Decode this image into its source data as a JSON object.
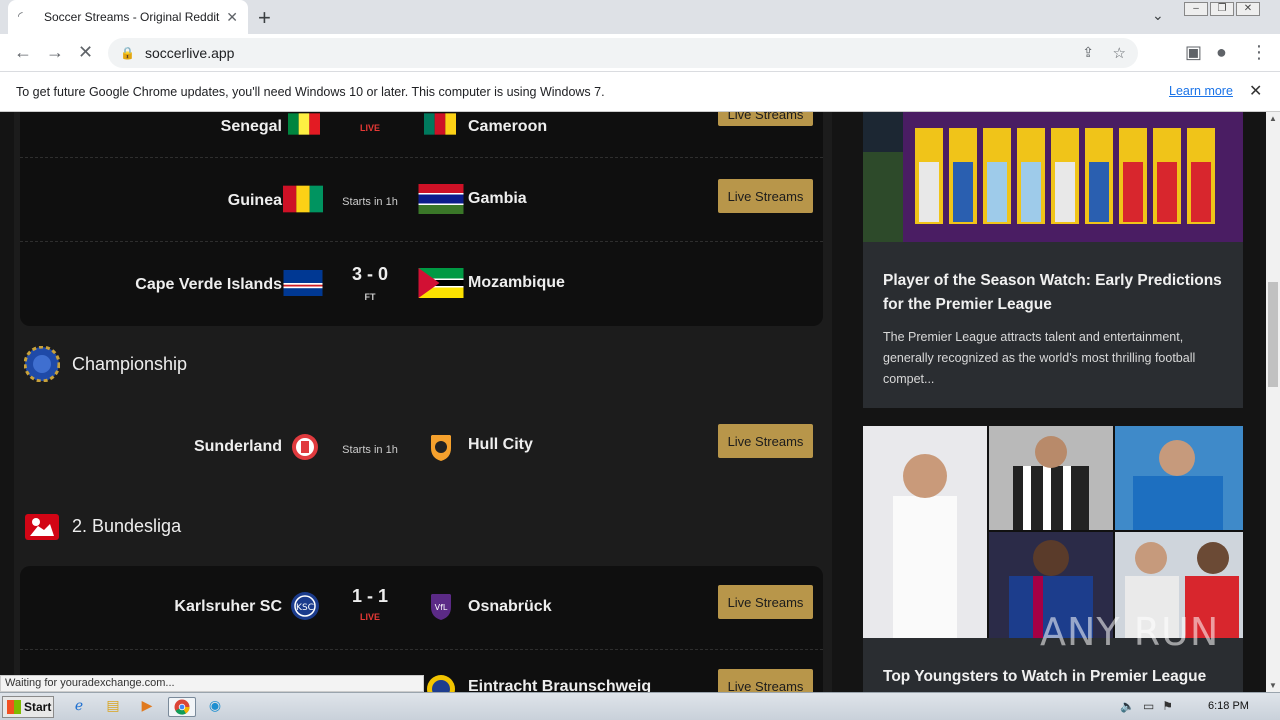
{
  "browser": {
    "tab_title": "Soccer Streams - Original Reddit Soc",
    "url": "soccerlive.app",
    "info_message": "To get future Google Chrome updates, you'll need Windows 10 or later. This computer is using Windows 7.",
    "learn_more": "Learn more",
    "status": "Waiting for youradexchange.com..."
  },
  "matches_top": [
    {
      "home": "Senegal",
      "away": "Cameroon",
      "status": "LIVE",
      "button": "Live Streams"
    },
    {
      "home": "Guinea",
      "away": "Gambia",
      "starts": "Starts in 1h",
      "button": "Live Streams"
    },
    {
      "home": "Cape Verde Islands",
      "away": "Mozambique",
      "score": "3 - 0",
      "status": "FT"
    }
  ],
  "leagues": [
    {
      "name": "Championship",
      "matches": [
        {
          "home": "Sunderland",
          "away": "Hull City",
          "starts": "Starts in 1h",
          "button": "Live Streams"
        }
      ]
    },
    {
      "name": "2. Bundesliga",
      "matches": [
        {
          "home": "Karlsruher SC",
          "away": "Osnabrück",
          "score": "1 - 1",
          "status": "LIVE",
          "button": "Live Streams"
        },
        {
          "away": "Eintracht Braunschweig",
          "button": "Live Streams"
        }
      ]
    }
  ],
  "articles": [
    {
      "title": "Player of the Season Watch: Early Predictions for the Premier League",
      "body": "The Premier League attracts talent and entertainment, generally recognized as the world's most thrilling football compet..."
    },
    {
      "title": "Top Youngsters to Watch in Premier League"
    }
  ],
  "watermark": "ANY RUN",
  "taskbar": {
    "start": "Start",
    "clock": "6:18 PM"
  }
}
